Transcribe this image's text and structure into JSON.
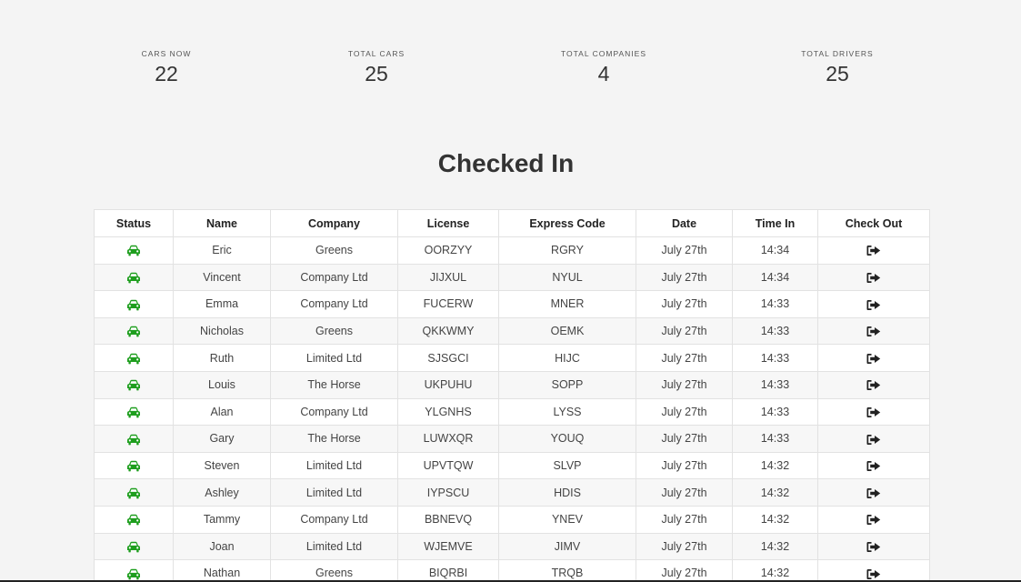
{
  "stats": [
    {
      "label": "CARS NOW",
      "value": "22"
    },
    {
      "label": "TOTAL CARS",
      "value": "25"
    },
    {
      "label": "TOTAL COMPANIES",
      "value": "4"
    },
    {
      "label": "TOTAL DRIVERS",
      "value": "25"
    }
  ],
  "heading": "Checked In",
  "table": {
    "columns": [
      "Status",
      "Name",
      "Company",
      "License",
      "Express Code",
      "Date",
      "Time In",
      "Check Out"
    ],
    "status_icon": "car-icon",
    "status_color": "#1e9e1e",
    "checkout_icon": "sign-out-icon",
    "rows": [
      {
        "name": "Eric",
        "company": "Greens",
        "license": "OORZYY",
        "code": "RGRY",
        "date": "July 27th",
        "time": "14:34"
      },
      {
        "name": "Vincent",
        "company": "Company Ltd",
        "license": "JIJXUL",
        "code": "NYUL",
        "date": "July 27th",
        "time": "14:34"
      },
      {
        "name": "Emma",
        "company": "Company Ltd",
        "license": "FUCERW",
        "code": "MNER",
        "date": "July 27th",
        "time": "14:33"
      },
      {
        "name": "Nicholas",
        "company": "Greens",
        "license": "QKKWMY",
        "code": "OEMK",
        "date": "July 27th",
        "time": "14:33"
      },
      {
        "name": "Ruth",
        "company": "Limited Ltd",
        "license": "SJSGCI",
        "code": "HIJC",
        "date": "July 27th",
        "time": "14:33"
      },
      {
        "name": "Louis",
        "company": "The Horse",
        "license": "UKPUHU",
        "code": "SOPP",
        "date": "July 27th",
        "time": "14:33"
      },
      {
        "name": "Alan",
        "company": "Company Ltd",
        "license": "YLGNHS",
        "code": "LYSS",
        "date": "July 27th",
        "time": "14:33"
      },
      {
        "name": "Gary",
        "company": "The Horse",
        "license": "LUWXQR",
        "code": "YOUQ",
        "date": "July 27th",
        "time": "14:33"
      },
      {
        "name": "Steven",
        "company": "Limited Ltd",
        "license": "UPVTQW",
        "code": "SLVP",
        "date": "July 27th",
        "time": "14:32"
      },
      {
        "name": "Ashley",
        "company": "Limited Ltd",
        "license": "IYPSCU",
        "code": "HDIS",
        "date": "July 27th",
        "time": "14:32"
      },
      {
        "name": "Tammy",
        "company": "Company Ltd",
        "license": "BBNEVQ",
        "code": "YNEV",
        "date": "July 27th",
        "time": "14:32"
      },
      {
        "name": "Joan",
        "company": "Limited Ltd",
        "license": "WJEMVE",
        "code": "JIMV",
        "date": "July 27th",
        "time": "14:32"
      },
      {
        "name": "Nathan",
        "company": "Greens",
        "license": "BIQRBI",
        "code": "TRQB",
        "date": "July 27th",
        "time": "14:32"
      }
    ]
  }
}
